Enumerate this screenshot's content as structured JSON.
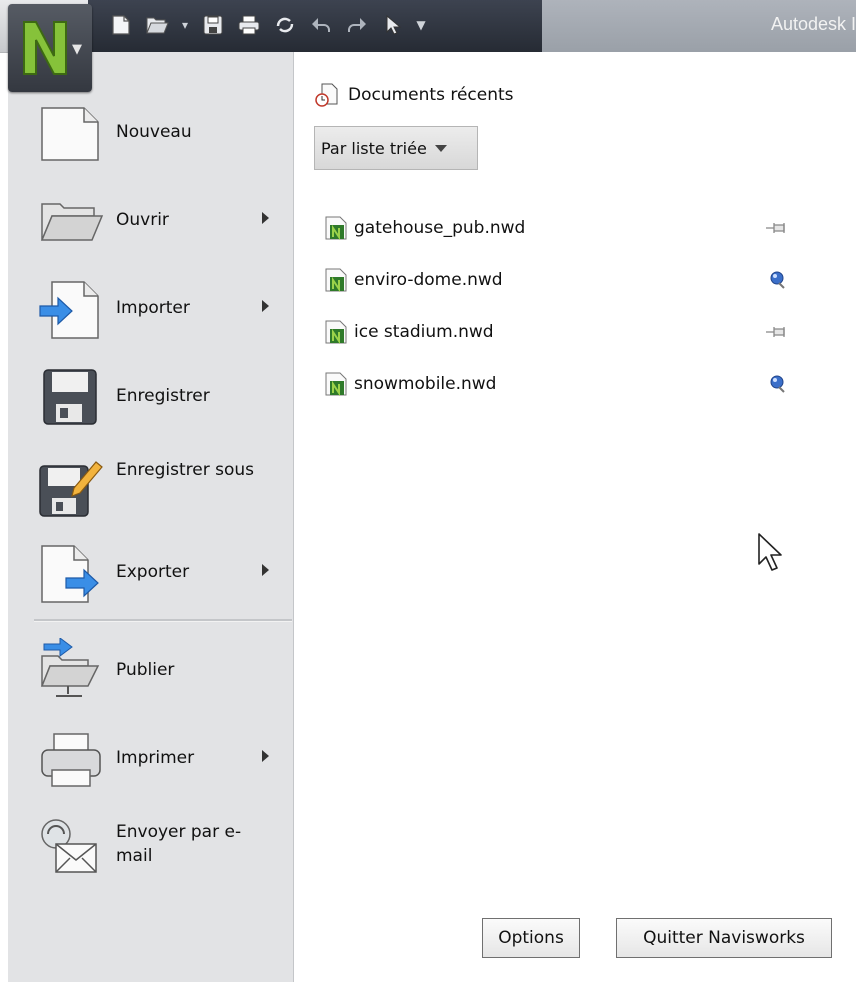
{
  "window": {
    "title": "Autodesk I"
  },
  "quick_access": {
    "icons": [
      "new-icon",
      "open-icon",
      "save-icon",
      "print-icon",
      "refresh-icon",
      "undo-icon",
      "redo-icon",
      "select-icon",
      "customize-icon"
    ]
  },
  "app_menu": {
    "items": [
      {
        "label": "Nouveau",
        "arrow": false
      },
      {
        "label": "Ouvrir",
        "arrow": true
      },
      {
        "label": "Importer",
        "arrow": true
      },
      {
        "label": "Enregistrer",
        "arrow": false
      },
      {
        "label": "Enregistrer sous",
        "arrow": false
      },
      {
        "label": "Exporter",
        "arrow": true
      },
      {
        "label": "Publier",
        "arrow": false
      },
      {
        "label": "Imprimer",
        "arrow": true
      },
      {
        "label": "Envoyer par e-mail",
        "arrow": false
      }
    ]
  },
  "recent": {
    "heading": "Documents récents",
    "sort_label": "Par liste triée",
    "files": [
      {
        "name": "gatehouse_pub.nwd",
        "pinned": false
      },
      {
        "name": "enviro-dome.nwd",
        "pinned": true
      },
      {
        "name": "ice stadium.nwd",
        "pinned": false
      },
      {
        "name": "snowmobile.nwd",
        "pinned": true
      }
    ]
  },
  "buttons": {
    "options": "Options",
    "quit": "Quitter Navisworks"
  }
}
